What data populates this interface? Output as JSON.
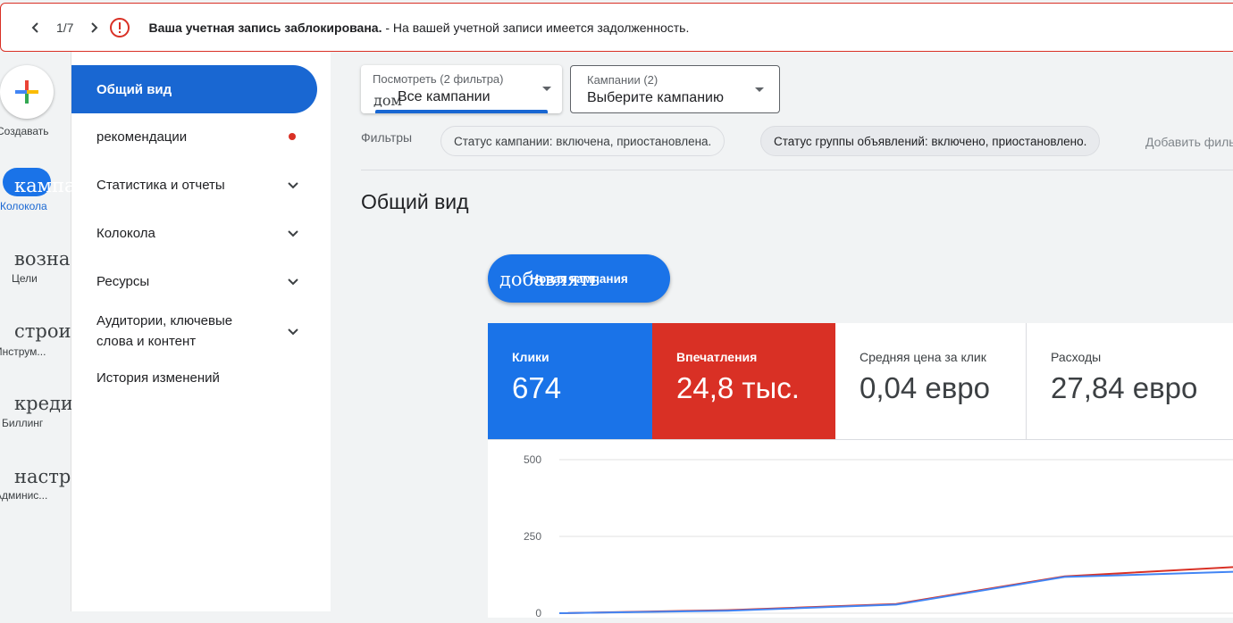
{
  "alert": {
    "counter": "1/7",
    "title": "Ваша учетная запись заблокирована.",
    "message": " - На вашей учетной записи имеется задолженность.",
    "color": "#d93025"
  },
  "rail": {
    "create_label": "Создавать",
    "items": [
      {
        "glyph": "кампа",
        "label": "Колокола",
        "active": true
      },
      {
        "glyph": "возна",
        "label": "Цели"
      },
      {
        "glyph": "строи",
        "label": "Инструм..."
      },
      {
        "glyph": "креди",
        "label": "Биллинг"
      },
      {
        "glyph": "настр",
        "label": "Админис..."
      }
    ]
  },
  "sidenav": {
    "items": [
      {
        "label": "Общий вид"
      },
      {
        "label": "рекомендации"
      },
      {
        "label": "Статистика и отчеты"
      },
      {
        "label": "Колокола"
      },
      {
        "label": "Ресурсы"
      },
      {
        "label": "Аудитории, ключевые слова и контент"
      },
      {
        "label": "История изменений"
      }
    ]
  },
  "toolbar": {
    "view_label": "Посмотреть (2 фильтра)",
    "view_value": "Все кампании",
    "view_ghost": "дом",
    "campaign_label": "Кампании (2)",
    "campaign_value": "Выберите кампанию"
  },
  "filters": {
    "label": "Фильтры",
    "chips": [
      "Статус кампании: включена, приостановлена.",
      "Статус группы объявлений: включено, приостановлено."
    ],
    "add": "Добавить фильтр"
  },
  "page_title": "Общий вид",
  "new_campaign": {
    "label": "Новая кампания",
    "ghost": "добавлять"
  },
  "metrics": [
    {
      "label": "Клики",
      "value": "674",
      "color": "#1a73e8"
    },
    {
      "label": "Впечатления",
      "value": "24,8 тыс.",
      "color": "#d93025"
    },
    {
      "label": "Средняя цена за клик",
      "value": "0,04 евро"
    },
    {
      "label": "Расходы",
      "value": "27,84 евро"
    }
  ],
  "chart_data": {
    "type": "line",
    "y_ticks": [
      "500",
      "250",
      "0"
    ],
    "ylim": [
      0,
      500
    ],
    "series": [
      {
        "color": "#d93025",
        "values": [
          0,
          10,
          30,
          120,
          150
        ]
      },
      {
        "color": "#4285f4",
        "values": [
          0,
          8,
          28,
          118,
          135
        ]
      }
    ]
  }
}
